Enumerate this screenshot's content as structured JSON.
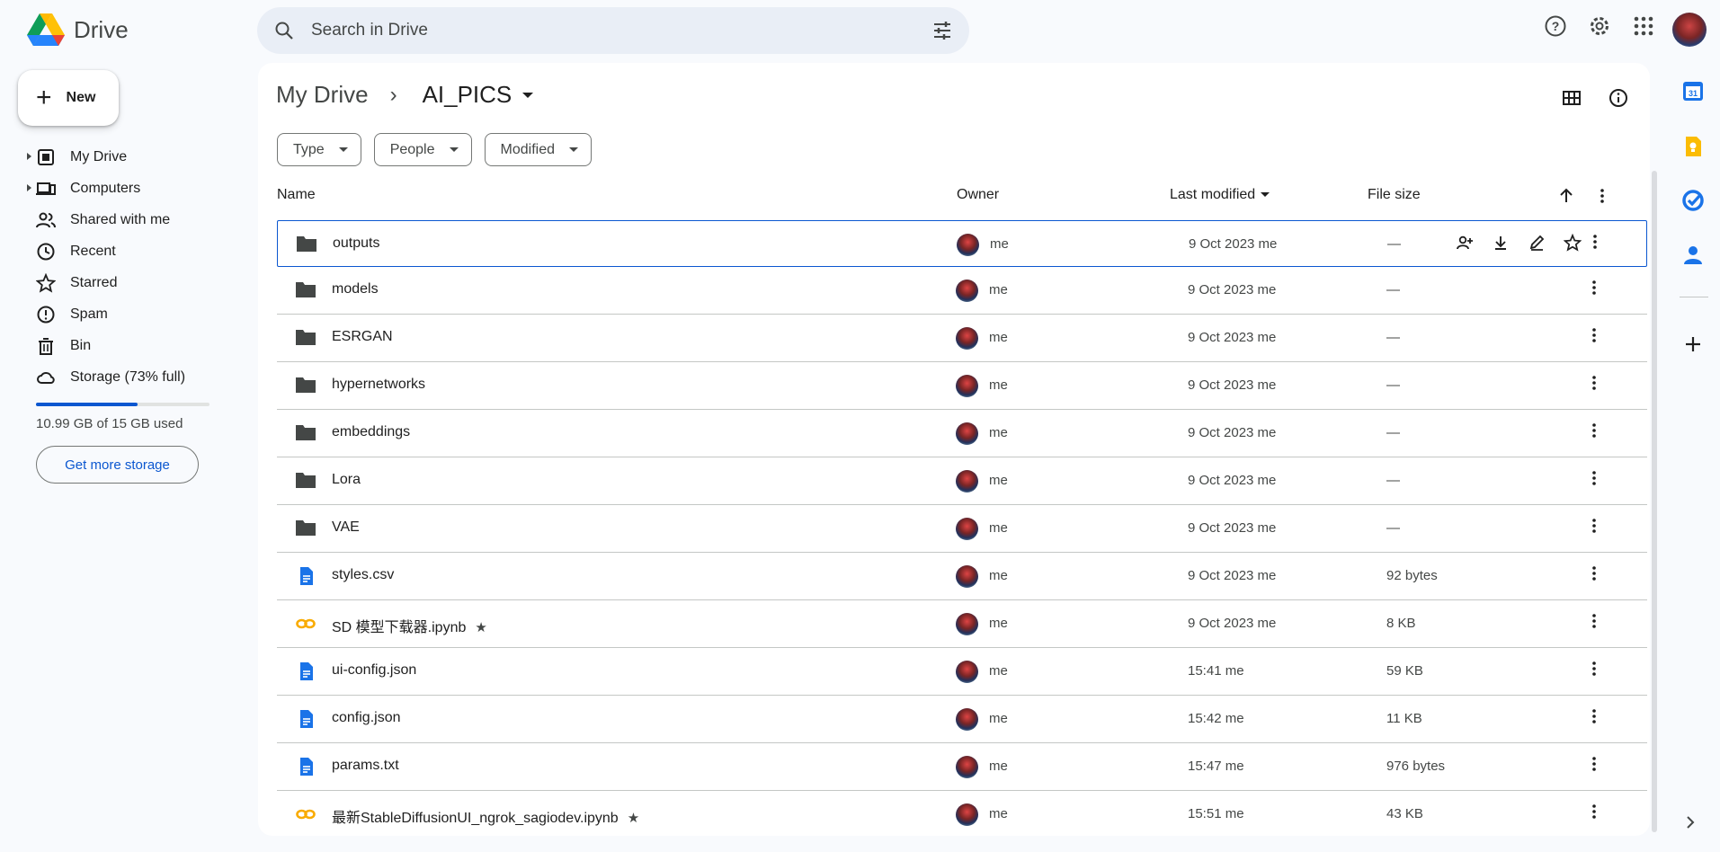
{
  "app": {
    "name": "Drive"
  },
  "search": {
    "placeholder": "Search in Drive"
  },
  "sidebar": {
    "new_label": "New",
    "items": [
      {
        "label": "My Drive",
        "icon": "my-drive-icon",
        "expandable": true
      },
      {
        "label": "Computers",
        "icon": "computers-icon",
        "expandable": true
      },
      {
        "label": "Shared with me",
        "icon": "shared-icon",
        "expandable": false
      },
      {
        "label": "Recent",
        "icon": "clock-icon",
        "expandable": false
      },
      {
        "label": "Starred",
        "icon": "star-icon",
        "expandable": false
      },
      {
        "label": "Spam",
        "icon": "spam-icon",
        "expandable": false
      },
      {
        "label": "Bin",
        "icon": "bin-icon",
        "expandable": false
      },
      {
        "label": "Storage (73% full)",
        "icon": "cloud-icon",
        "expandable": false
      }
    ],
    "storage_used_fraction": 0.73,
    "storage_text": "10.99 GB of 15 GB used",
    "get_storage_label": "Get more storage"
  },
  "breadcrumb": {
    "root": "My Drive",
    "current": "AI_PICS"
  },
  "filters": [
    "Type",
    "People",
    "Modified"
  ],
  "table": {
    "headers": {
      "name": "Name",
      "owner": "Owner",
      "last_modified": "Last modified",
      "file_size": "File size"
    },
    "rows": [
      {
        "name": "outputs",
        "type": "folder",
        "owner": "me",
        "modified": "9 Oct 2023 me",
        "size": "—",
        "starred": false,
        "selected": true
      },
      {
        "name": "models",
        "type": "folder",
        "owner": "me",
        "modified": "9 Oct 2023 me",
        "size": "—",
        "starred": false
      },
      {
        "name": "ESRGAN",
        "type": "folder",
        "owner": "me",
        "modified": "9 Oct 2023 me",
        "size": "—",
        "starred": false
      },
      {
        "name": "hypernetworks",
        "type": "folder",
        "owner": "me",
        "modified": "9 Oct 2023 me",
        "size": "—",
        "starred": false
      },
      {
        "name": "embeddings",
        "type": "folder",
        "owner": "me",
        "modified": "9 Oct 2023 me",
        "size": "—",
        "starred": false
      },
      {
        "name": "Lora",
        "type": "folder",
        "owner": "me",
        "modified": "9 Oct 2023 me",
        "size": "—",
        "starred": false
      },
      {
        "name": "VAE",
        "type": "folder",
        "owner": "me",
        "modified": "9 Oct 2023 me",
        "size": "—",
        "starred": false
      },
      {
        "name": "styles.csv",
        "type": "doc",
        "owner": "me",
        "modified": "9 Oct 2023 me",
        "size": "92 bytes",
        "starred": false
      },
      {
        "name": "SD 模型下载器.ipynb",
        "type": "colab",
        "owner": "me",
        "modified": "9 Oct 2023 me",
        "size": "8 KB",
        "starred": true
      },
      {
        "name": "ui-config.json",
        "type": "doc",
        "owner": "me",
        "modified": "15:41 me",
        "size": "59 KB",
        "starred": false
      },
      {
        "name": "config.json",
        "type": "doc",
        "owner": "me",
        "modified": "15:42 me",
        "size": "11 KB",
        "starred": false
      },
      {
        "name": "params.txt",
        "type": "doc",
        "owner": "me",
        "modified": "15:47 me",
        "size": "976 bytes",
        "starred": false
      },
      {
        "name": "最新StableDiffusionUI_ngrok_sagiodev.ipynb",
        "type": "colab",
        "owner": "me",
        "modified": "15:51 me",
        "size": "43 KB",
        "starred": true
      }
    ]
  },
  "colors": {
    "accent": "#0b57d0",
    "folder": "#444746",
    "doc": "#1a73e8",
    "colab": "#f9ab00"
  }
}
